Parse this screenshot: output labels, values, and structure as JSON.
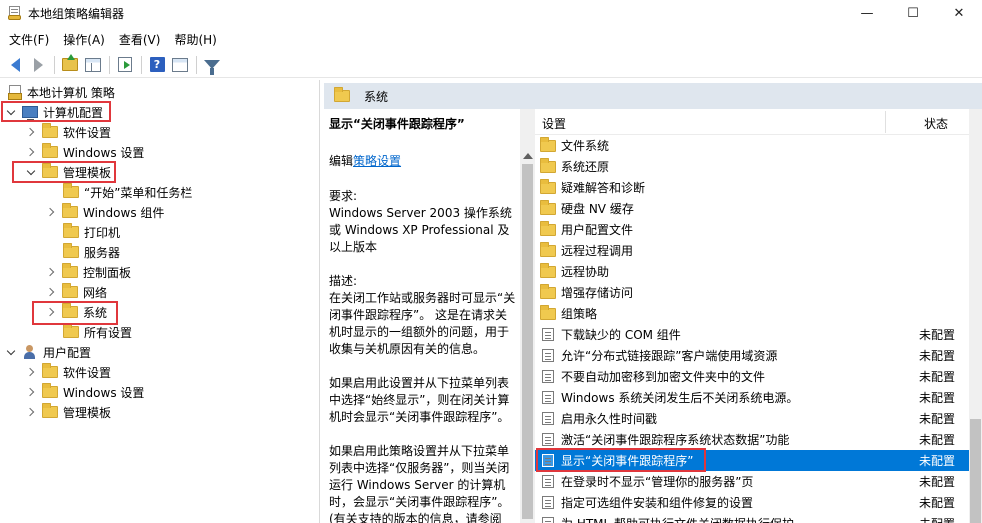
{
  "window": {
    "title": "本地组策略编辑器",
    "minimize_glyph": "—",
    "maximize_glyph": "☐",
    "close_glyph": "✕"
  },
  "menu": [
    {
      "label": "文件(F)"
    },
    {
      "label": "操作(A)"
    },
    {
      "label": "查看(V)"
    },
    {
      "label": "帮助(H)"
    }
  ],
  "toolbar": {
    "icons": [
      "back-arrow-icon",
      "forward-arrow-icon",
      "up-folder-icon",
      "show-hide-tree-icon",
      "export-list-icon",
      "help-icon",
      "properties-icon",
      "filter-icon"
    ],
    "help_glyph": "?"
  },
  "tree": {
    "root": "本地计算机 策略",
    "computer_config": "计算机配置",
    "cc_software": "软件设置",
    "cc_windows": "Windows 设置",
    "cc_admin": "管理模板",
    "start_menu": "“开始”菜单和任务栏",
    "windows_components": "Windows 组件",
    "printers": "打印机",
    "server": "服务器",
    "control_panel": "控制面板",
    "network": "网络",
    "system": "系统",
    "all_settings": "所有设置",
    "user_config": "用户配置",
    "uc_software": "软件设置",
    "uc_windows": "Windows 设置",
    "uc_admin": "管理模板"
  },
  "right_header": {
    "title": "系统"
  },
  "description": {
    "title": "显示“关闭事件跟踪程序”",
    "edit_prefix": "编辑",
    "edit_link": "策略设置",
    "requirements": "要求:\nWindows Server 2003 操作系统或 Windows XP Professional 及以上版本",
    "description": "描述:\n在关闭工作站或服务器时可显示“关闭事件跟踪程序”。 这是在请求关机时显示的一组额外的问题，用于收集与关机原因有关的信息。",
    "para_enabled": "如果启用此设置并从下拉菜单列表中选择“始终显示”，则在闭关计算机时会显示“关闭事件跟踪程序”。",
    "para_server": "如果启用此策略设置并从下拉菜单列表中选择“仅服务器”，则当关闭运行 Windows Server 的计算机时，会显示“关闭事件跟踪程序”。(有关支持的版本的信息，请参阅"
  },
  "list": {
    "col_setting": "设置",
    "col_state": "状态",
    "folders": [
      "文件系统",
      "系统还原",
      "疑难解答和诊断",
      "硬盘 NV 缓存",
      "用户配置文件",
      "远程过程调用",
      "远程协助",
      "增强存储访问",
      "组策略"
    ],
    "policies": [
      {
        "name": "下载缺少的 COM 组件",
        "state": "未配置"
      },
      {
        "name": "允许“分布式链接跟踪”客户端使用域资源",
        "state": "未配置"
      },
      {
        "name": "不要自动加密移到加密文件夹中的文件",
        "state": "未配置"
      },
      {
        "name": "Windows 系统关闭发生后不关闭系统电源。",
        "state": "未配置"
      },
      {
        "name": "启用永久性时间戳",
        "state": "未配置"
      },
      {
        "name": "激活“关闭事件跟踪程序系统状态数据”功能",
        "state": "未配置"
      },
      {
        "name": "显示“关闭事件跟踪程序”",
        "state": "未配置"
      },
      {
        "name": "在登录时不显示“管理你的服务器”页",
        "state": "未配置"
      },
      {
        "name": "指定可选组件安装和组件修复的设置",
        "state": "未配置"
      },
      {
        "name": "为 HTML 帮助可执行文件关闭数据执行保护",
        "state": "未配置"
      }
    ]
  },
  "colors": {
    "selection": "#0078d7",
    "highlight_box": "#e0373c",
    "header_bg": "#dfe6ee",
    "link": "#0066cc"
  }
}
